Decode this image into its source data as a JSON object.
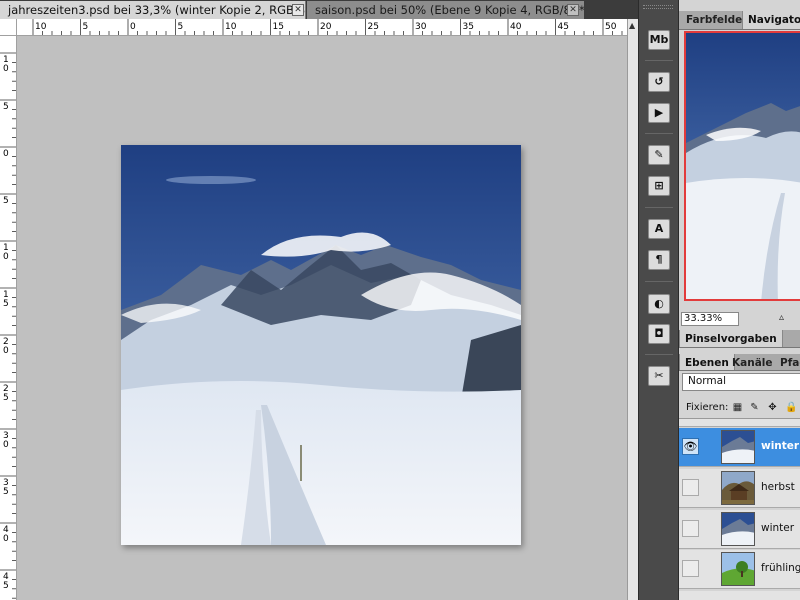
{
  "tabs": [
    {
      "label": "jahreszeiten3.psd bei 33,3% (winter Kopie 2, RGB/8) *",
      "active": true
    },
    {
      "label": "saison.psd bei 50% (Ebene 9 Kopie 4, RGB/8) *",
      "active": false
    }
  ],
  "tab_close_glyph": "✕",
  "ruler": {
    "top": [
      "10",
      "5",
      "0",
      "5",
      "10",
      "15",
      "20",
      "25",
      "30",
      "35",
      "40",
      "45",
      "50",
      "55"
    ],
    "left": [
      "1\n0",
      "5",
      "0",
      "5",
      "1\n0",
      "1\n5",
      "2\n0",
      "2\n5",
      "3\n0",
      "3\n5",
      "4\n0",
      "4\n5"
    ]
  },
  "tools": [
    {
      "icon": "mini-bridge-icon",
      "glyph": "Mb"
    },
    {
      "icon": "history-icon",
      "glyph": "↺"
    },
    {
      "icon": "actions-icon",
      "glyph": "▶"
    },
    {
      "icon": "brush-presets-icon",
      "glyph": "✎"
    },
    {
      "icon": "clone-source-icon",
      "glyph": "⊞"
    },
    {
      "icon": "character-icon",
      "glyph": "A"
    },
    {
      "icon": "paragraph-icon",
      "glyph": "¶"
    },
    {
      "icon": "adjustments-icon",
      "glyph": "◐"
    },
    {
      "icon": "masks-icon",
      "glyph": "◘"
    },
    {
      "icon": "tools-icon",
      "glyph": "✂"
    }
  ],
  "panel_top": {
    "tabs": [
      "Farbfelder",
      "Navigator"
    ],
    "active": "Navigator"
  },
  "navigator": {
    "zoom": "33.33%",
    "zoom_out_glyph": "▵"
  },
  "pinsel_panel": {
    "tab": "Pinselvorgaben"
  },
  "layers_panel": {
    "tabs": [
      "Ebenen",
      "Kanäle",
      "Pfad"
    ],
    "active": "Ebenen",
    "blend_mode": "Normal",
    "lock_label": "Fixieren:",
    "lock_icons": [
      "▦",
      "✎",
      "✥",
      "🔒"
    ],
    "eye_glyph": "👁",
    "layers": [
      {
        "name": "winter K",
        "selected": true,
        "visible": true,
        "thumb": "winter"
      },
      {
        "name": "herbst",
        "selected": false,
        "visible": false,
        "thumb": "herbst"
      },
      {
        "name": "winter",
        "selected": false,
        "visible": false,
        "thumb": "winter"
      },
      {
        "name": "frühling",
        "selected": false,
        "visible": false,
        "thumb": "fruehling"
      }
    ]
  },
  "colors": {
    "canvas_bg": "#c0c0c0",
    "selection": "#3d8ee0",
    "navigator_frame": "#e23b3b",
    "sky_top": "#1f3f82",
    "sky_bottom": "#5b82bf"
  }
}
